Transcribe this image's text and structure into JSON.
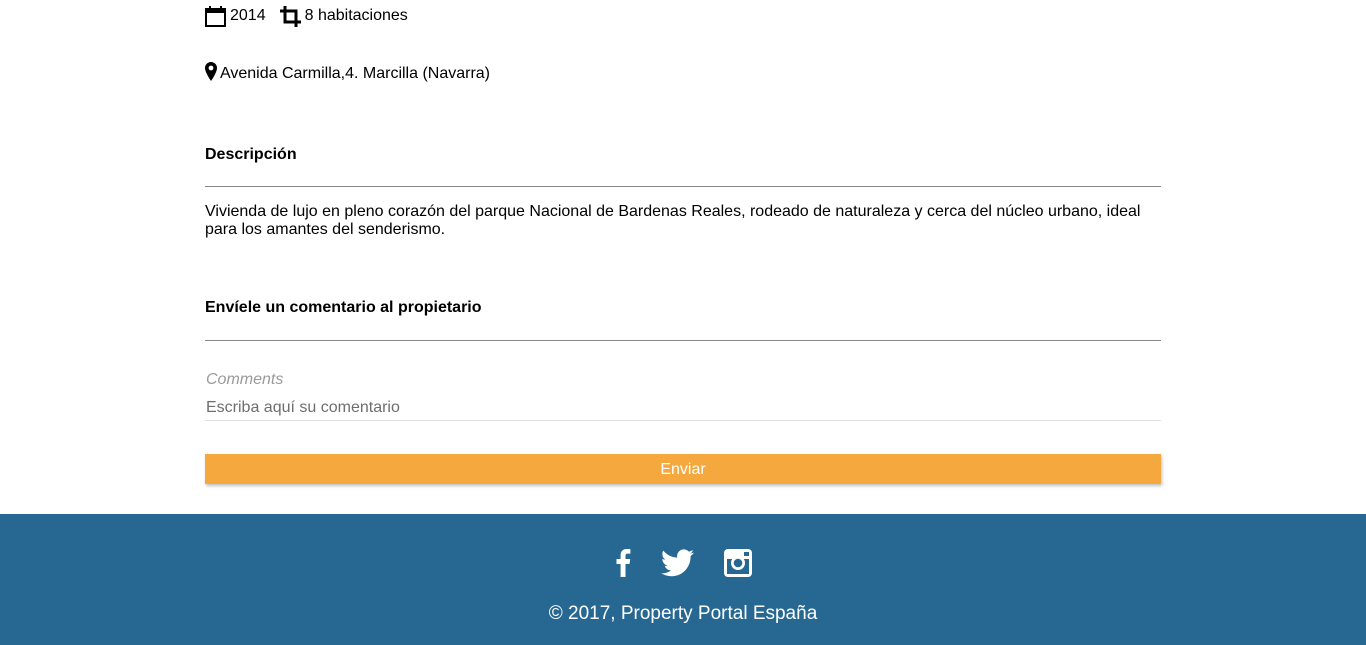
{
  "property": {
    "year": "2014",
    "rooms": "8 habitaciones",
    "address": "Avenida Carmilla,4. Marcilla (Navarra)",
    "icons": {
      "year": "calendar-icon",
      "rooms": "crop-icon",
      "address": "map-marker-icon"
    }
  },
  "description": {
    "title": "Descripción",
    "text": "Vivienda de lujo en pleno corazón del parque Nacional de Bardenas Reales, rodeado de naturaleza y cerca del núcleo urbano, ideal para los amantes del senderismo."
  },
  "comment_form": {
    "title": "Envíele un comentario al propietario",
    "label": "Comments",
    "placeholder": "Escriba aquí su comentario",
    "value": "",
    "submit_label": "Enviar"
  },
  "footer": {
    "social": [
      "facebook-icon",
      "twitter-icon",
      "instagram-icon"
    ],
    "copyright": "© 2017, Property Portal España"
  },
  "colors": {
    "accent": "#f4a83d",
    "footer_bg": "#276893",
    "rule": "#888888"
  }
}
